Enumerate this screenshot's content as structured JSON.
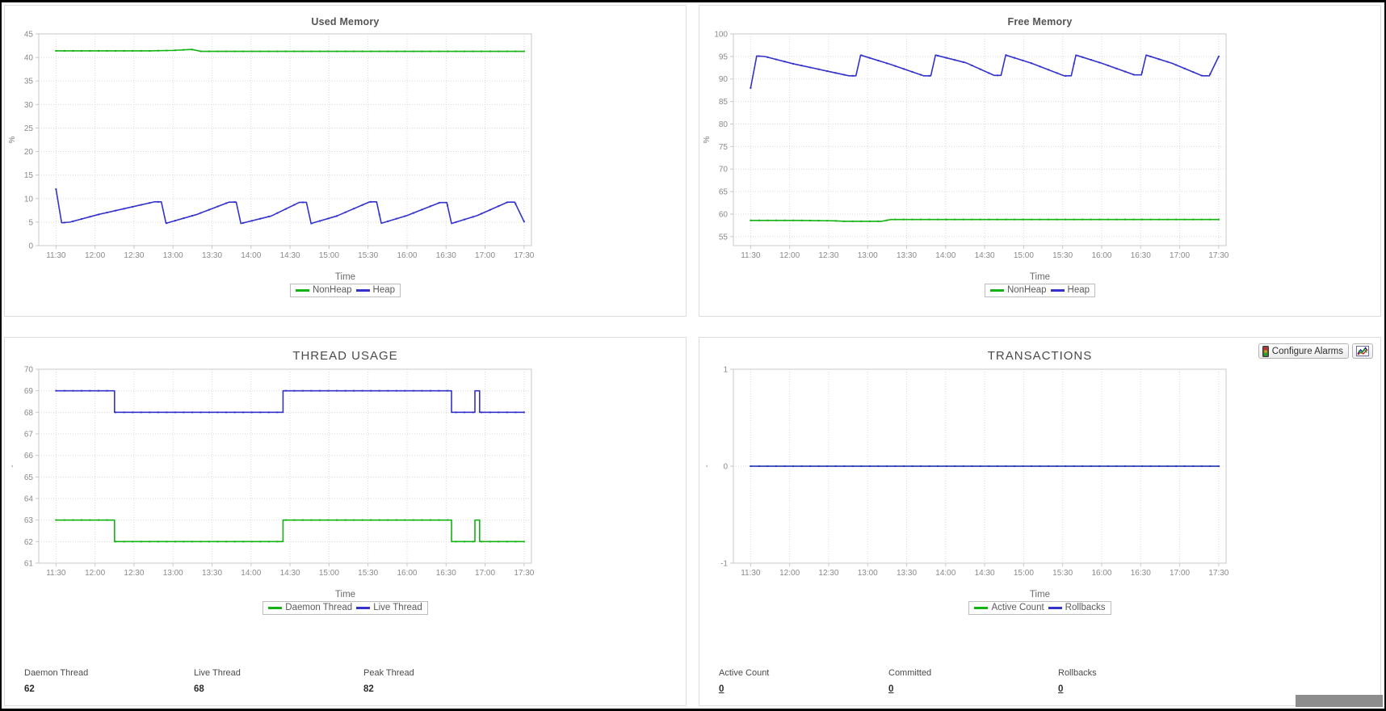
{
  "toolbar": {
    "configure_alarms_label": "Configure Alarms",
    "alarm_icon": "traffic-light-icon",
    "chart_icon": "chart-image-icon"
  },
  "panels": {
    "used_memory": {
      "title": "Used Memory"
    },
    "free_memory": {
      "title": "Free Memory"
    },
    "thread_usage": {
      "title": "THREAD USAGE"
    },
    "transactions": {
      "title": "TRANSACTIONS"
    }
  },
  "thread_stats": [
    {
      "label": "Daemon Thread",
      "value": "62",
      "link": false
    },
    {
      "label": "Live Thread",
      "value": "68",
      "link": false
    },
    {
      "label": "Peak Thread",
      "value": "82",
      "link": false
    }
  ],
  "transaction_stats": [
    {
      "label": "Active Count",
      "value": "0",
      "link": true
    },
    {
      "label": "Committed",
      "value": "0",
      "link": true
    },
    {
      "label": "Rollbacks",
      "value": "0",
      "link": true
    }
  ],
  "colors": {
    "series_green": "#13b313",
    "series_blue": "#3333cc",
    "grid": "#d9d9d9",
    "axis": "#c8c8c8",
    "text": "#8a8a8a"
  },
  "chart_data": [
    {
      "id": "used_memory",
      "type": "line",
      "title": "Used Memory",
      "xlabel": "Time",
      "ylabel": "%",
      "ylim": [
        0,
        45
      ],
      "yticks": [
        0,
        5,
        10,
        15,
        20,
        25,
        30,
        35,
        40,
        45
      ],
      "xticks": [
        "11:30",
        "12:00",
        "12:30",
        "13:00",
        "13:30",
        "14:00",
        "14:30",
        "15:00",
        "15:30",
        "16:00",
        "16:30",
        "17:00",
        "17:30"
      ],
      "grid": true,
      "legend_position": "bottom",
      "series": [
        {
          "name": "NonHeap",
          "color": "#13b313",
          "x": [
            0,
            0.08,
            0.15,
            0.2,
            0.25,
            0.29,
            0.31,
            0.33,
            0.36,
            0.5,
            0.7,
            0.85,
            1.0
          ],
          "values": [
            41.4,
            41.4,
            41.4,
            41.4,
            41.5,
            41.7,
            41.3,
            41.3,
            41.3,
            41.3,
            41.3,
            41.3,
            41.3
          ]
        },
        {
          "name": "Heap",
          "color": "#3333cc",
          "x": [
            0.0,
            0.012,
            0.03,
            0.09,
            0.17,
            0.21,
            0.225,
            0.235,
            0.3,
            0.37,
            0.385,
            0.395,
            0.46,
            0.52,
            0.535,
            0.545,
            0.6,
            0.67,
            0.685,
            0.695,
            0.75,
            0.82,
            0.835,
            0.845,
            0.9,
            0.965,
            0.98,
            1.0
          ],
          "values": [
            12.0,
            4.85,
            5.0,
            6.6,
            8.4,
            9.3,
            9.3,
            4.75,
            6.6,
            9.25,
            9.25,
            4.7,
            6.3,
            9.2,
            9.2,
            4.7,
            6.3,
            9.3,
            9.3,
            4.75,
            6.4,
            9.15,
            9.15,
            4.7,
            6.4,
            9.25,
            9.25,
            5.1
          ]
        }
      ]
    },
    {
      "id": "free_memory",
      "type": "line",
      "title": "Free Memory",
      "xlabel": "Time",
      "ylabel": "%",
      "ylim": [
        53,
        100
      ],
      "yticks": [
        55,
        60,
        65,
        70,
        75,
        80,
        85,
        90,
        95,
        100
      ],
      "xticks": [
        "11:30",
        "12:00",
        "12:30",
        "13:00",
        "13:30",
        "14:00",
        "14:30",
        "15:00",
        "15:30",
        "16:00",
        "16:30",
        "17:00",
        "17:30"
      ],
      "grid": true,
      "legend_position": "bottom",
      "series": [
        {
          "name": "NonHeap",
          "color": "#13b313",
          "x": [
            0,
            0.1,
            0.18,
            0.2,
            0.25,
            0.28,
            0.3,
            0.33,
            0.5,
            0.75,
            1.0
          ],
          "values": [
            58.6,
            58.6,
            58.5,
            58.4,
            58.4,
            58.4,
            58.8,
            58.8,
            58.8,
            58.8,
            58.8
          ]
        },
        {
          "name": "Heap",
          "color": "#3333cc",
          "x": [
            0.0,
            0.013,
            0.03,
            0.09,
            0.17,
            0.21,
            0.225,
            0.235,
            0.3,
            0.37,
            0.385,
            0.395,
            0.46,
            0.52,
            0.535,
            0.545,
            0.6,
            0.67,
            0.685,
            0.695,
            0.75,
            0.82,
            0.835,
            0.845,
            0.9,
            0.965,
            0.98,
            1.0
          ],
          "values": [
            88.0,
            95.1,
            95.0,
            93.4,
            91.6,
            90.7,
            90.7,
            95.3,
            93.2,
            90.7,
            90.7,
            95.3,
            93.6,
            90.8,
            90.8,
            95.3,
            93.5,
            90.7,
            90.7,
            95.3,
            93.5,
            90.9,
            90.9,
            95.3,
            93.5,
            90.7,
            90.7,
            95.0
          ]
        }
      ]
    },
    {
      "id": "thread_usage",
      "type": "line",
      "title": "THREAD USAGE",
      "xlabel": "Time",
      "ylabel": "-",
      "ylim": [
        61,
        70
      ],
      "yticks": [
        61,
        62,
        63,
        64,
        65,
        66,
        67,
        68,
        69,
        70
      ],
      "xticks": [
        "11:30",
        "12:00",
        "12:30",
        "13:00",
        "13:30",
        "14:00",
        "14:30",
        "15:00",
        "15:30",
        "16:00",
        "16:30",
        "17:00",
        "17:30"
      ],
      "grid": true,
      "legend_position": "bottom",
      "series": [
        {
          "name": "Daemon Thread",
          "color": "#13b313",
          "x": [
            0.0,
            0.115,
            0.125,
            0.47,
            0.485,
            0.835,
            0.845,
            0.885,
            0.895,
            0.905,
            0.915,
            1.0
          ],
          "values": [
            63,
            63,
            62,
            62,
            63,
            63,
            62,
            62,
            63,
            62,
            62,
            62
          ]
        },
        {
          "name": "Live Thread",
          "color": "#3333cc",
          "x": [
            0.0,
            0.115,
            0.125,
            0.47,
            0.485,
            0.835,
            0.845,
            0.885,
            0.895,
            0.905,
            0.915,
            1.0
          ],
          "values": [
            69,
            69,
            68,
            68,
            69,
            69,
            68,
            68,
            69,
            68,
            68,
            68
          ]
        }
      ]
    },
    {
      "id": "transactions",
      "type": "line",
      "title": "TRANSACTIONS",
      "xlabel": "Time",
      "ylabel": "-",
      "ylim": [
        -1,
        1
      ],
      "yticks": [
        -1,
        0,
        1
      ],
      "xticks": [
        "11:30",
        "12:00",
        "12:30",
        "13:00",
        "13:30",
        "14:00",
        "14:30",
        "15:00",
        "15:30",
        "16:00",
        "16:30",
        "17:00",
        "17:30"
      ],
      "grid": true,
      "legend_position": "bottom",
      "series": [
        {
          "name": "Active Count",
          "color": "#13b313",
          "x": [
            0,
            1
          ],
          "values": [
            0,
            0
          ]
        },
        {
          "name": "Rollbacks",
          "color": "#3333cc",
          "x": [
            0,
            1
          ],
          "values": [
            0,
            0
          ]
        }
      ]
    }
  ]
}
